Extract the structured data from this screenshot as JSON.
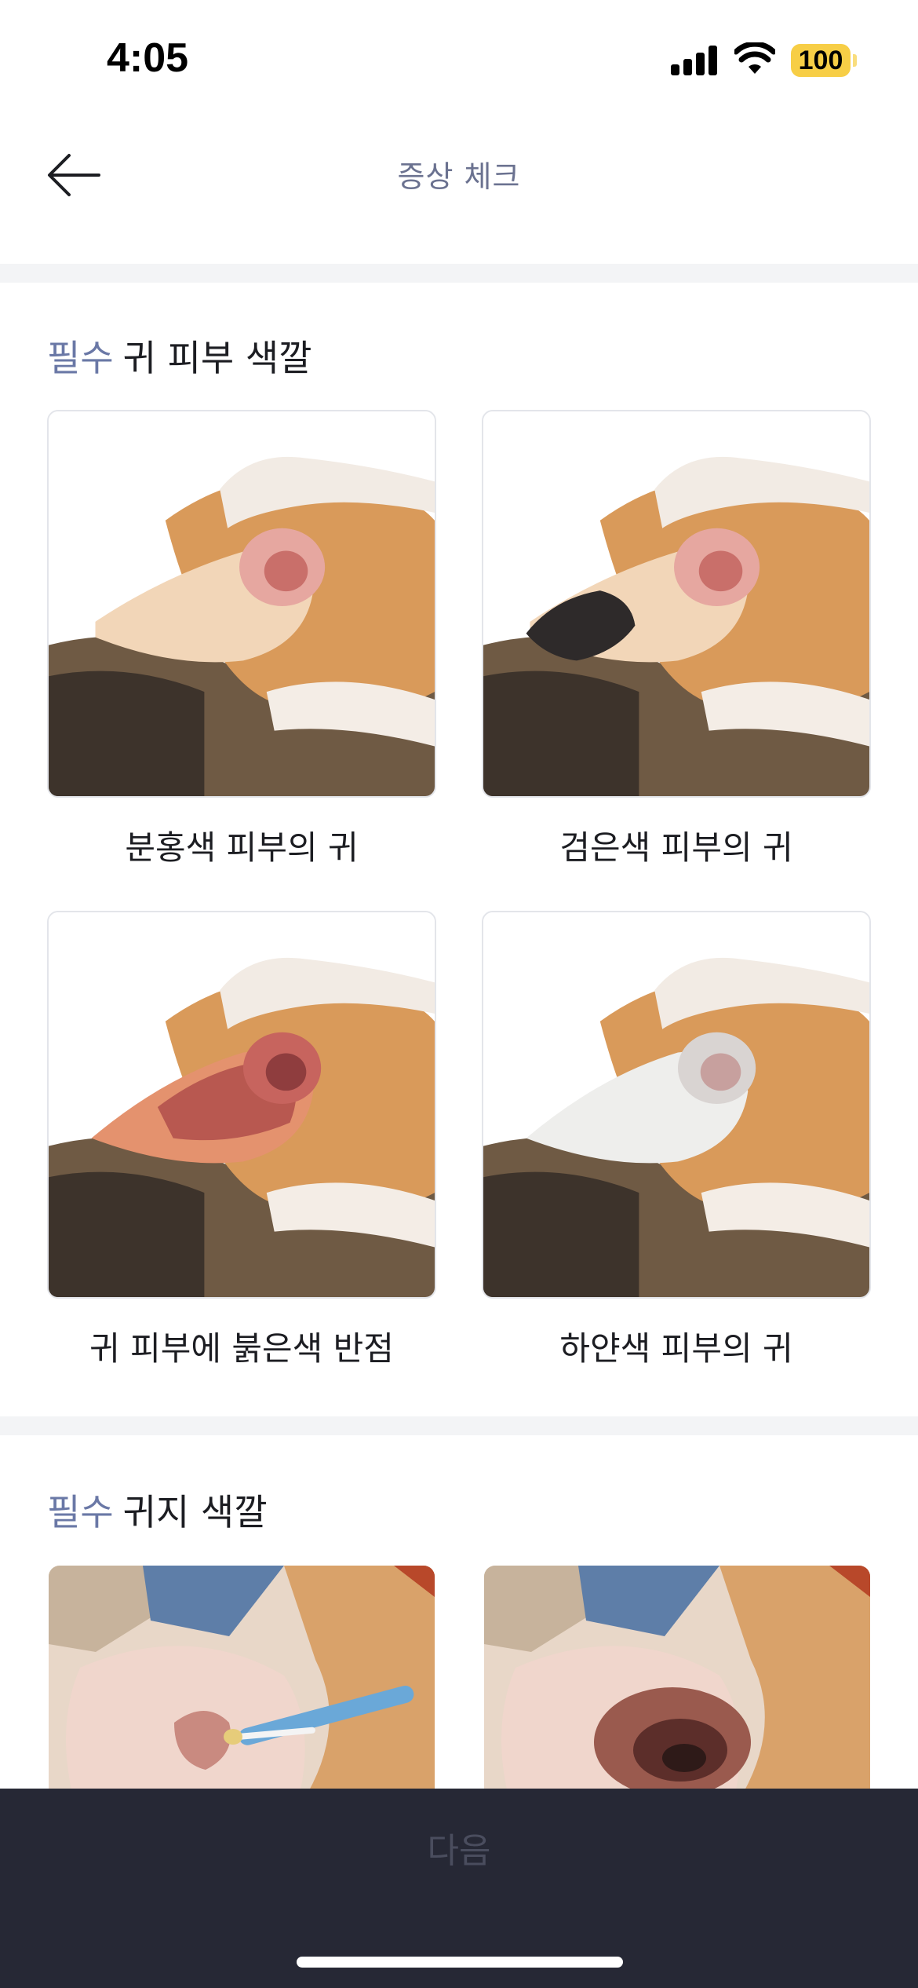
{
  "status_bar": {
    "time": "4:05",
    "battery": "100",
    "icons": [
      "cellular-signal-icon",
      "wifi-icon",
      "battery-icon"
    ]
  },
  "header": {
    "title": "증상 체크",
    "back_icon": "arrow-left-icon"
  },
  "sections": [
    {
      "required_tag": "필수",
      "title": "귀 피부 색깔",
      "options": [
        {
          "label": "분홍색 피부의 귀",
          "variant": "pink"
        },
        {
          "label": "검은색 피부의 귀",
          "variant": "black"
        },
        {
          "label": "귀 피부에 붉은색 반점",
          "variant": "red"
        },
        {
          "label": "하얀색 피부의 귀",
          "variant": "white"
        }
      ]
    },
    {
      "required_tag": "필수",
      "title": "귀지 색깔",
      "options": [
        {
          "label": "",
          "variant": "swab"
        },
        {
          "label": "",
          "variant": "dark-wax"
        }
      ]
    }
  ],
  "footer": {
    "next_label": "다음"
  },
  "colors": {
    "accent_required": "#6a78a6",
    "header_title": "#6b7290",
    "bottom_bar": "#262835",
    "next_disabled_text": "#4a4d5e",
    "battery": "#f7ce46"
  }
}
